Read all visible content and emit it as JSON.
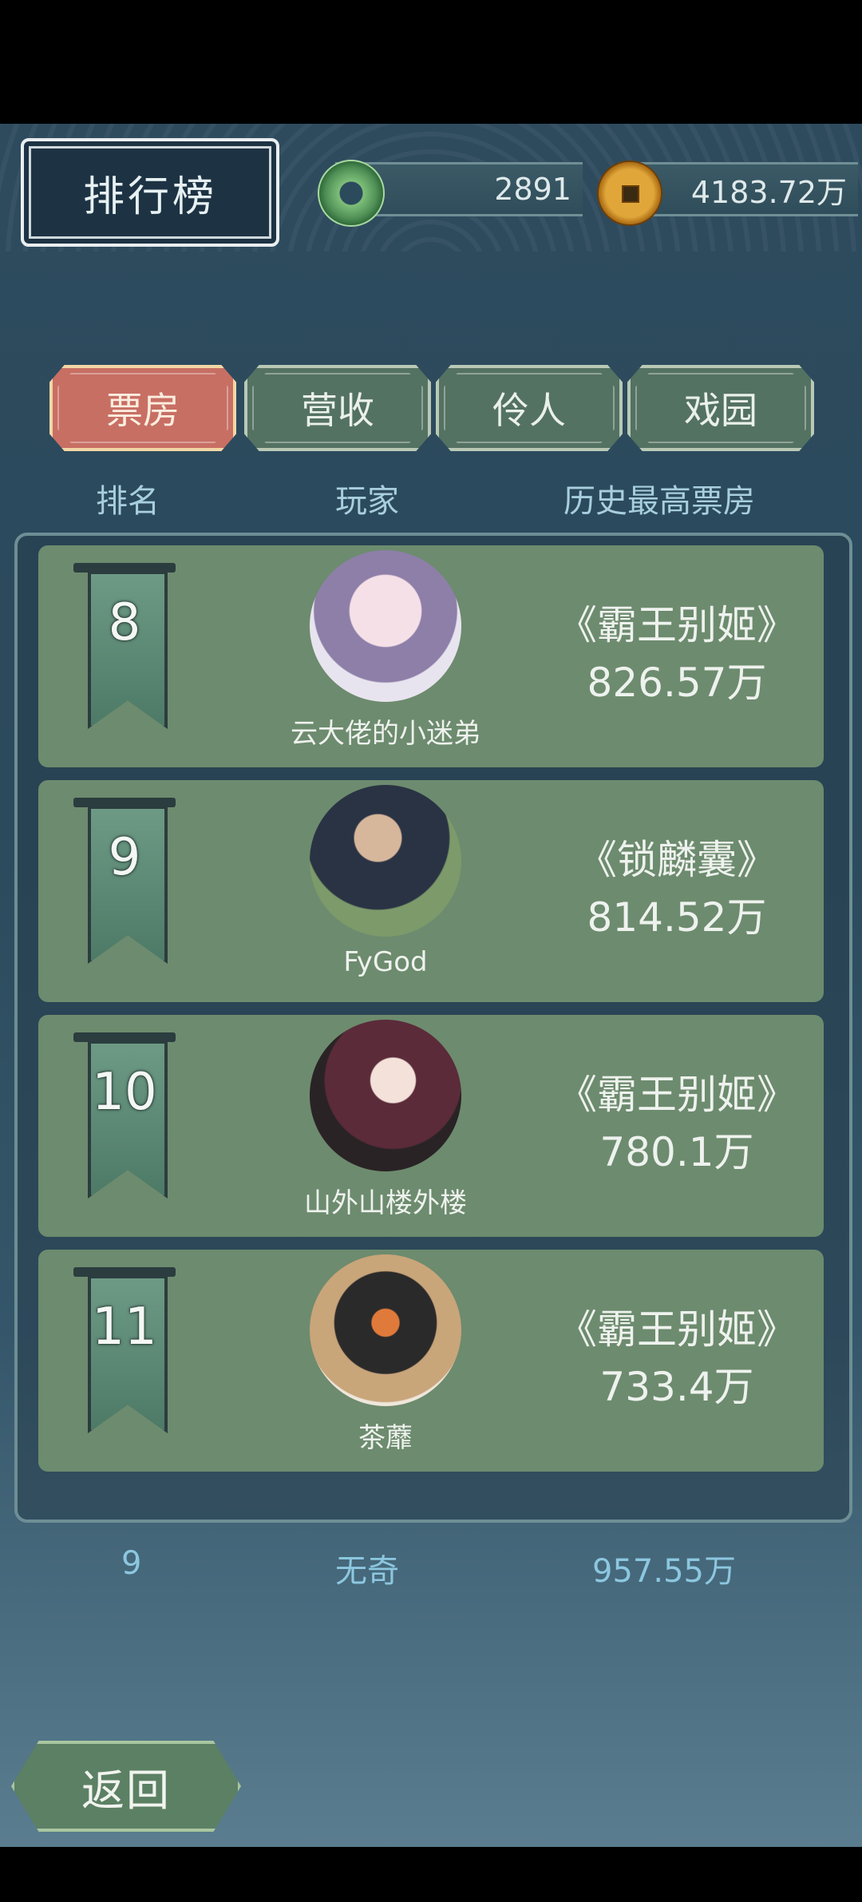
{
  "header": {
    "title": "排行榜"
  },
  "currencies": {
    "jade": "2891",
    "coins": "4183.72万"
  },
  "tabs": [
    {
      "label": "票房",
      "active": true
    },
    {
      "label": "营收",
      "active": false
    },
    {
      "label": "伶人",
      "active": false
    },
    {
      "label": "戏园",
      "active": false
    }
  ],
  "columns": {
    "rank": "排名",
    "player": "玩家",
    "best": "历史最高票房"
  },
  "rows": [
    {
      "rank": "8",
      "player": "云大佬的小迷弟",
      "play": "《霸王别姬》",
      "amount": "826.57万"
    },
    {
      "rank": "9",
      "player": "FyGod",
      "play": "《锁麟囊》",
      "amount": "814.52万"
    },
    {
      "rank": "10",
      "player": "山外山楼外楼",
      "play": "《霸王别姬》",
      "amount": "780.1万"
    },
    {
      "rank": "11",
      "player": "茶蘼",
      "play": "《霸王别姬》",
      "amount": "733.4万"
    }
  ],
  "self": {
    "rank": "9",
    "player": "无奇",
    "amount": "957.55万"
  },
  "footer": {
    "back_label": "返回"
  },
  "colors": {
    "active_tab": "#c86f64",
    "tab": "#547262",
    "row": "#6d8b6e",
    "self_text": "#8cc7e0"
  }
}
